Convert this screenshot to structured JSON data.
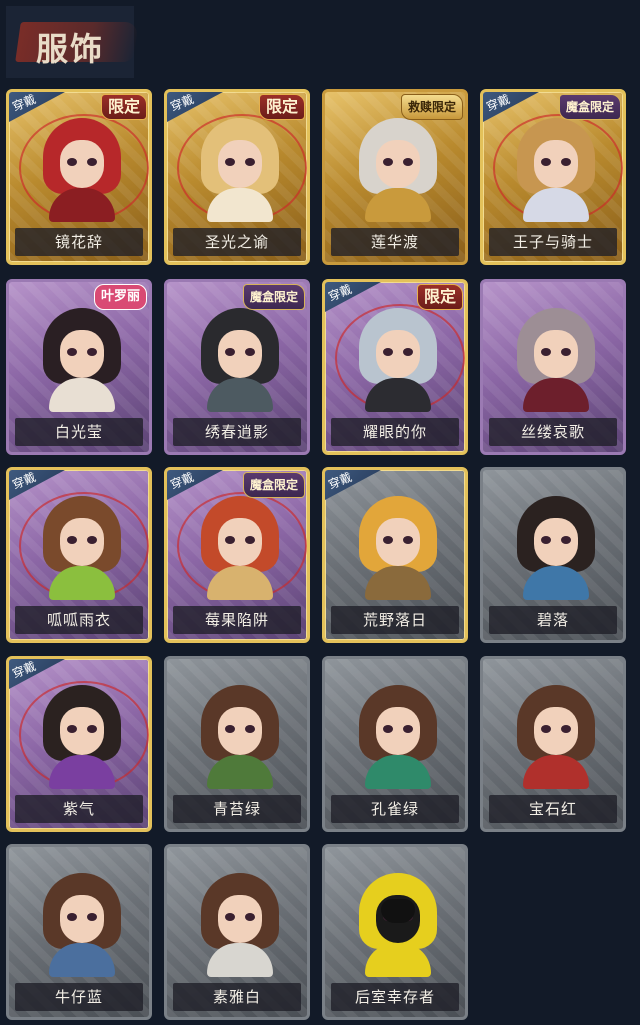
{
  "header": {
    "title": "服饰"
  },
  "equip_label": "穿戴",
  "costumes": [
    {
      "name": "镜花辞",
      "frame": "gold",
      "tag": "限定",
      "tag_style": "red",
      "equipped": true,
      "ring": true,
      "hair": "#b7282a",
      "body": "#8b1e22"
    },
    {
      "name": "圣光之谕",
      "frame": "gold",
      "tag": "限定",
      "tag_style": "red",
      "equipped": true,
      "ring": true,
      "hair": "#e3c079",
      "body": "#f2e6cf"
    },
    {
      "name": "莲华渡",
      "frame": "gold",
      "tag": "救赎限定",
      "tag_style": "hero",
      "equipped": false,
      "ring": false,
      "hair": "#d8d3cc",
      "body": "#c99a3c"
    },
    {
      "name": "王子与骑士",
      "frame": "gold",
      "tag": "魔盒限定",
      "tag_style": "boxed",
      "equipped": true,
      "ring": true,
      "hair": "#c79650",
      "body": "#d6d9e6"
    },
    {
      "name": "白光莹",
      "frame": "purple",
      "tag": "叶罗丽",
      "tag_style": "xr",
      "equipped": false,
      "ring": false,
      "hair": "#2a1f23",
      "body": "#e8dfd3"
    },
    {
      "name": "绣春逍影",
      "frame": "purple",
      "tag": "魔盒限定",
      "tag_style": "boxed",
      "equipped": false,
      "ring": false,
      "hair": "#2a2a2e",
      "body": "#4d5a61"
    },
    {
      "name": "耀眼的你",
      "frame": "purple",
      "tag": "限定",
      "tag_style": "red",
      "equipped": true,
      "ring": true,
      "hair": "#b9c4cf",
      "body": "#2c2c31"
    },
    {
      "name": "丝缕哀歌",
      "frame": "purple",
      "tag": "",
      "tag_style": "",
      "equipped": false,
      "ring": false,
      "hair": "#9d8e95",
      "body": "#6d1f2c"
    },
    {
      "name": "呱呱雨衣",
      "frame": "purple",
      "tag": "",
      "tag_style": "",
      "equipped": true,
      "ring": true,
      "hair": "#7a4a2c",
      "body": "#8bbf3e"
    },
    {
      "name": "莓果陷阱",
      "frame": "purple",
      "tag": "魔盒限定",
      "tag_style": "boxed",
      "equipped": true,
      "ring": true,
      "hair": "#c34a2a",
      "body": "#d8b26e"
    },
    {
      "name": "荒野落日",
      "frame": "grey",
      "tag": "",
      "tag_style": "",
      "equipped": true,
      "ring": false,
      "hair": "#e2a63a",
      "body": "#8a6a3c"
    },
    {
      "name": "碧落",
      "frame": "grey",
      "tag": "",
      "tag_style": "",
      "equipped": false,
      "ring": false,
      "hair": "#2b2220",
      "body": "#3f77a8"
    },
    {
      "name": "紫气",
      "frame": "purple",
      "tag": "",
      "tag_style": "",
      "equipped": true,
      "ring": true,
      "hair": "#2b2220",
      "body": "#7a3fa0"
    },
    {
      "name": "青苔绿",
      "frame": "grey",
      "tag": "",
      "tag_style": "",
      "equipped": false,
      "ring": false,
      "hair": "#5a3828",
      "body": "#4f7a3a"
    },
    {
      "name": "孔雀绿",
      "frame": "grey",
      "tag": "",
      "tag_style": "",
      "equipped": false,
      "ring": false,
      "hair": "#5a3828",
      "body": "#2f8a6a"
    },
    {
      "name": "宝石红",
      "frame": "grey",
      "tag": "",
      "tag_style": "",
      "equipped": false,
      "ring": false,
      "hair": "#5a3828",
      "body": "#b0302c"
    },
    {
      "name": "牛仔蓝",
      "frame": "grey",
      "tag": "",
      "tag_style": "",
      "equipped": false,
      "ring": false,
      "hair": "#5a3828",
      "body": "#4b6f9e"
    },
    {
      "name": "素雅白",
      "frame": "grey",
      "tag": "",
      "tag_style": "",
      "equipped": false,
      "ring": false,
      "hair": "#5a3828",
      "body": "#d8d6d0"
    },
    {
      "name": "后室幸存者",
      "frame": "grey",
      "tag": "",
      "tag_style": "",
      "equipped": false,
      "ring": false,
      "hair": "#e6cf1e",
      "body": "#e6cf1e",
      "mask": true
    }
  ]
}
